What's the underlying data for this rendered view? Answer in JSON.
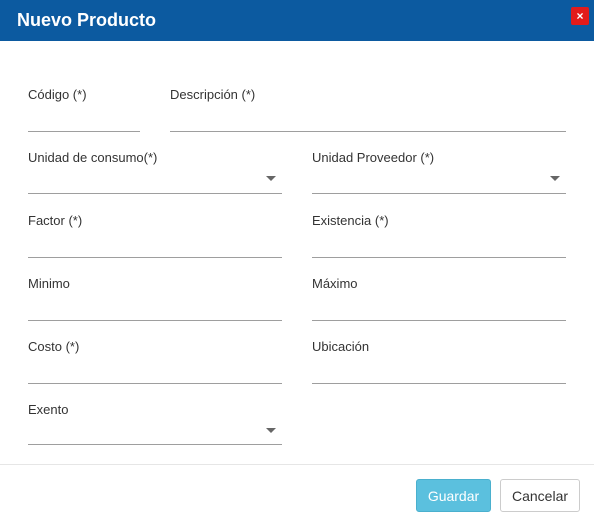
{
  "window": {
    "title": "Nuevo Producto",
    "close_label": "×"
  },
  "form": {
    "codigo": {
      "label": "Código (*)",
      "value": ""
    },
    "descripcion": {
      "label": "Descripción (*)",
      "value": ""
    },
    "unidad_consumo": {
      "label": "Unidad de consumo(*)",
      "selected": ""
    },
    "unidad_proveedor": {
      "label": "Unidad Proveedor (*)",
      "selected": ""
    },
    "factor": {
      "label": "Factor (*)",
      "value": ""
    },
    "existencia": {
      "label": "Existencia (*)",
      "value": ""
    },
    "minimo": {
      "label": "Minimo",
      "value": ""
    },
    "maximo": {
      "label": "Máximo",
      "value": ""
    },
    "costo": {
      "label": "Costo (*)",
      "value": ""
    },
    "ubicacion": {
      "label": "Ubicación",
      "value": ""
    },
    "exento": {
      "label": "Exento",
      "selected": ""
    }
  },
  "footer": {
    "save_label": "Guardar",
    "cancel_label": "Cancelar"
  },
  "colors": {
    "header": "#0c5aa0",
    "close": "#e21b1b",
    "save_button": "#5bc0de"
  }
}
